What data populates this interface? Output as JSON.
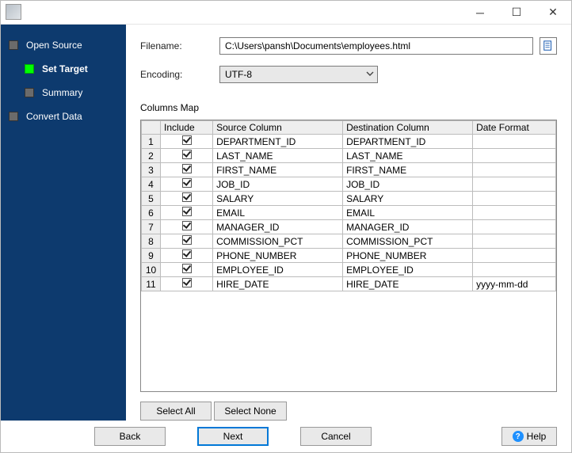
{
  "titlebar": {
    "title": ""
  },
  "nav": {
    "items": [
      {
        "label": "Open Source",
        "sub": false,
        "active": false
      },
      {
        "label": "Set Target",
        "sub": true,
        "active": true
      },
      {
        "label": "Summary",
        "sub": true,
        "active": false
      },
      {
        "label": "Convert Data",
        "sub": false,
        "active": false
      }
    ]
  },
  "form": {
    "filename_label": "Filename:",
    "filename_value": "C:\\Users\\pansh\\Documents\\employees.html",
    "encoding_label": "Encoding:",
    "encoding_value": "UTF-8",
    "columns_map_label": "Columns Map"
  },
  "grid": {
    "headers": [
      "",
      "Include",
      "Source Column",
      "Destination Column",
      "Date Format"
    ],
    "rows": [
      {
        "n": "1",
        "include": true,
        "src": "DEPARTMENT_ID",
        "dst": "DEPARTMENT_ID",
        "fmt": ""
      },
      {
        "n": "2",
        "include": true,
        "src": "LAST_NAME",
        "dst": "LAST_NAME",
        "fmt": ""
      },
      {
        "n": "3",
        "include": true,
        "src": "FIRST_NAME",
        "dst": "FIRST_NAME",
        "fmt": ""
      },
      {
        "n": "4",
        "include": true,
        "src": "JOB_ID",
        "dst": "JOB_ID",
        "fmt": ""
      },
      {
        "n": "5",
        "include": true,
        "src": "SALARY",
        "dst": "SALARY",
        "fmt": ""
      },
      {
        "n": "6",
        "include": true,
        "src": "EMAIL",
        "dst": "EMAIL",
        "fmt": ""
      },
      {
        "n": "7",
        "include": true,
        "src": "MANAGER_ID",
        "dst": "MANAGER_ID",
        "fmt": ""
      },
      {
        "n": "8",
        "include": true,
        "src": "COMMISSION_PCT",
        "dst": "COMMISSION_PCT",
        "fmt": ""
      },
      {
        "n": "9",
        "include": true,
        "src": "PHONE_NUMBER",
        "dst": "PHONE_NUMBER",
        "fmt": ""
      },
      {
        "n": "10",
        "include": true,
        "src": "EMPLOYEE_ID",
        "dst": "EMPLOYEE_ID",
        "fmt": ""
      },
      {
        "n": "11",
        "include": true,
        "src": "HIRE_DATE",
        "dst": "HIRE_DATE",
        "fmt": "yyyy-mm-dd"
      }
    ]
  },
  "buttons": {
    "select_all": "Select All",
    "select_none": "Select None",
    "back": "Back",
    "next": "Next",
    "cancel": "Cancel",
    "help": "Help"
  }
}
